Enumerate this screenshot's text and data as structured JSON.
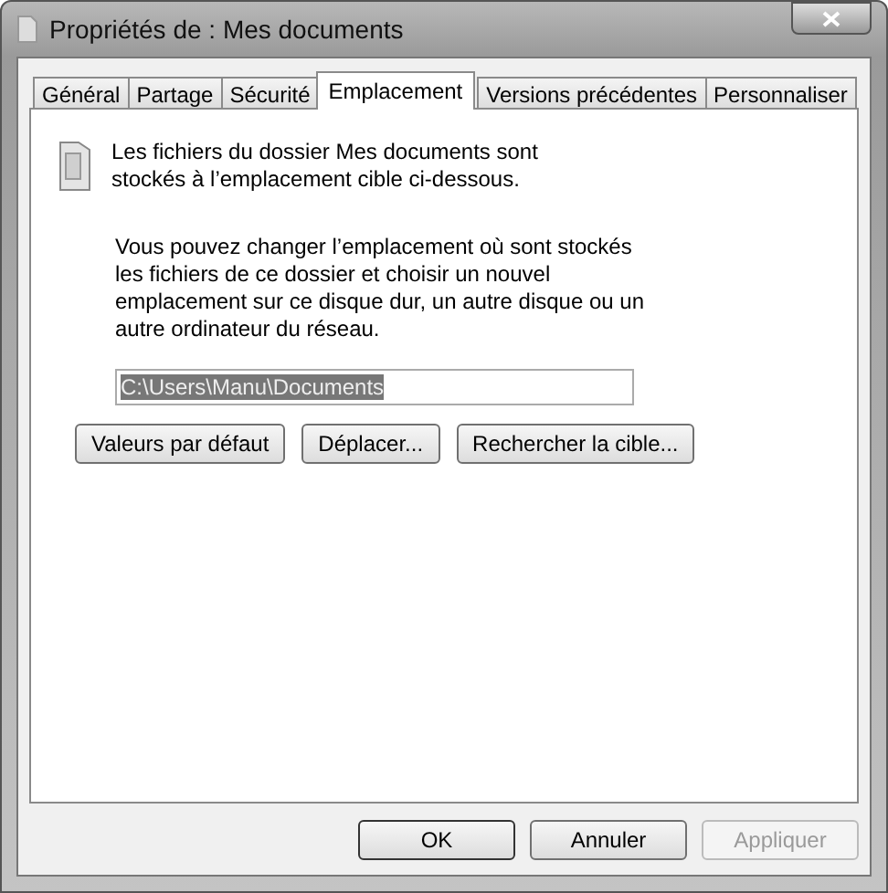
{
  "window": {
    "title": "Propriétés de : Mes documents"
  },
  "tabs": [
    {
      "label": "Général",
      "selected": false
    },
    {
      "label": "Partage",
      "selected": false
    },
    {
      "label": "Sécurité",
      "selected": false
    },
    {
      "label": "Emplacement",
      "selected": true
    },
    {
      "label": "Versions précédentes",
      "selected": false
    },
    {
      "label": "Personnaliser",
      "selected": false
    }
  ],
  "info": "Les fichiers du dossier Mes documents sont stockés à l’emplacement cible ci-dessous.",
  "description": "Vous pouvez changer l’emplacement où sont stockés les fichiers de ce dossier et choisir un nouvel emplacement sur ce disque dur, un autre disque ou un autre ordinateur du réseau.",
  "path_field": {
    "value": "C:\\Users\\Manu\\Documents",
    "text_selected": true
  },
  "location_buttons": [
    {
      "label": "Valeurs par défaut"
    },
    {
      "label": "Déplacer..."
    },
    {
      "label": "Rechercher la cible..."
    }
  ],
  "buttons": [
    {
      "label": "OK",
      "disabled": false,
      "default": true
    },
    {
      "label": "Annuler",
      "disabled": false,
      "default": false
    },
    {
      "label": "Appliquer",
      "disabled": true,
      "default": false
    }
  ]
}
